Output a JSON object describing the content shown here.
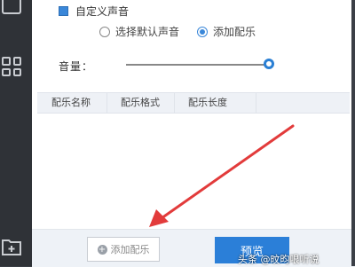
{
  "sound": {
    "custom_sound_label": "自定义声音",
    "option_default": "选择默认声音",
    "option_add_music": "添加配乐",
    "selected_option": "添加配乐"
  },
  "volume": {
    "label": "音量：",
    "level": 1.0
  },
  "table": {
    "columns": [
      "配乐名称",
      "配乐格式",
      "配乐长度"
    ],
    "rows": []
  },
  "footer": {
    "add_music_label": "添加配乐",
    "preview_label": "预览"
  },
  "watermark": "头条 @旼昀哏听说",
  "colors": {
    "accent": "#2b7fd8",
    "annotation_arrow": "#e23b3b"
  },
  "icons": {
    "add": "plus-circle-icon",
    "rail": [
      "grid-icon",
      "folder-add-icon"
    ]
  }
}
